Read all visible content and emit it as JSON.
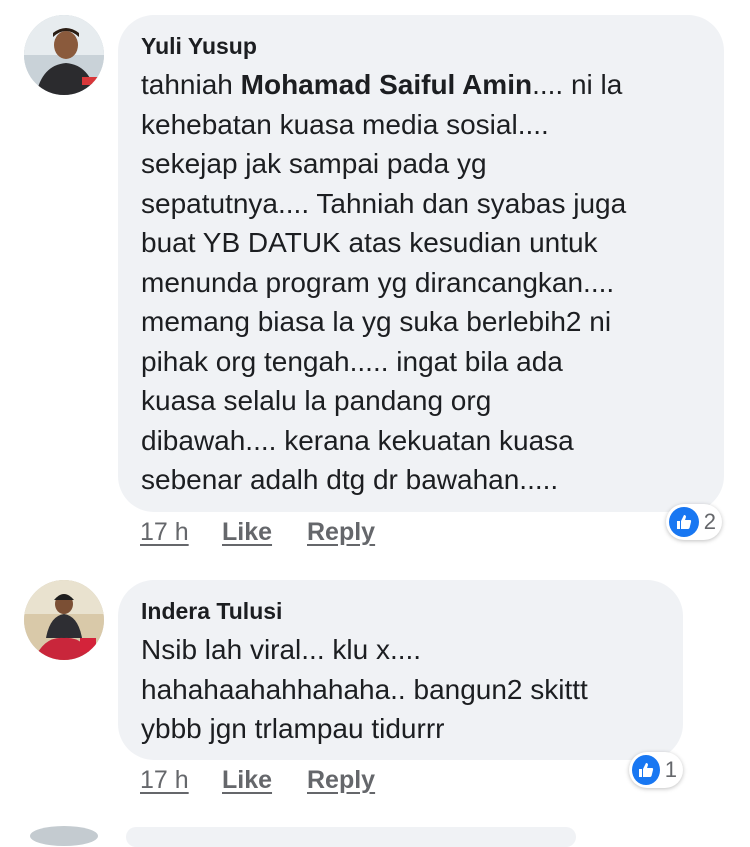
{
  "comments": [
    {
      "author": "Yuli Yusup",
      "text_parts": {
        "prefix": "tahniah ",
        "mention": "Mohamad Saiful Amin",
        "lines": [
          ".... ni la",
          "kehebatan kuasa media sosial....",
          "sekejap jak sampai pada yg",
          "sepatutnya.... Tahniah dan syabas juga",
          "buat YB DATUK atas kesudian untuk",
          "menunda program yg dirancangkan....",
          "memang biasa la yg suka berlebih2 ni",
          "pihak org tengah..... ingat bila ada",
          "kuasa selalu la pandang org",
          "dibawah.... kerana kekuatan kuasa",
          "sebenar adalh dtg dr bawahan....."
        ]
      },
      "time": "17 h",
      "like_label": "Like",
      "reply_label": "Reply",
      "reaction_count": "2"
    },
    {
      "author": "Indera Tulusi",
      "lines": [
        "Nsib lah viral... klu x....",
        "hahahaahahhahaha.. bangun2 skittt",
        "ybbb jgn trlampau tidurrr"
      ],
      "time": "17 h",
      "like_label": "Like",
      "reply_label": "Reply",
      "reaction_count": "1"
    }
  ],
  "colors": {
    "bubble": "#f0f2f5",
    "text": "#1c1e21",
    "meta": "#65676b",
    "like_blue": "#1877f2"
  },
  "icons": [
    "like-thumb-icon"
  ]
}
